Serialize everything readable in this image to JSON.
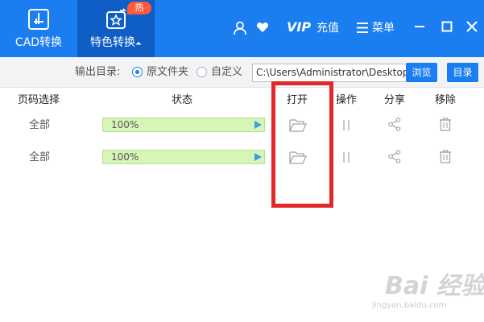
{
  "nav": {
    "cad_label": "CAD转换",
    "special_label": "特色转换",
    "special_arrow": "⏶",
    "hot_badge": "热"
  },
  "header": {
    "vip": "VIP",
    "vip_sub": "充值",
    "menu_label": "菜单"
  },
  "toolbar": {
    "output_label": "输出目录:",
    "option_original": "原文件夹",
    "option_custom": "自定义",
    "selected_option": "原文件夹",
    "path_value": "C:\\Users\\Administrator\\Desktop",
    "browse_label": "浏览",
    "directory_label": "目录"
  },
  "table": {
    "headers": [
      "页码选择",
      "状态",
      "打开",
      "操作",
      "分享",
      "移除"
    ],
    "rows": [
      {
        "pages": "全部",
        "progress_text": "100%",
        "progress": 1.0
      },
      {
        "pages": "全部",
        "progress_text": "100%",
        "progress": 1.0
      }
    ]
  },
  "watermark": {
    "main": "Bai 经验",
    "sub": "jingyan.baidu.com"
  },
  "colors": {
    "accent": "#1a7ef0",
    "accent_dark": "#0f5ec6",
    "progress_fill": "#d8f5b8",
    "highlight": "#e2262a",
    "badge": "#ff5a3c"
  },
  "icons": [
    "cad-convert-icon",
    "special-convert-icon",
    "user-icon",
    "heart-icon",
    "menu-icon",
    "minimize-icon",
    "maximize-icon",
    "close-icon",
    "folder-icon",
    "pause-icon",
    "share-icon",
    "trash-icon",
    "play-icon"
  ]
}
